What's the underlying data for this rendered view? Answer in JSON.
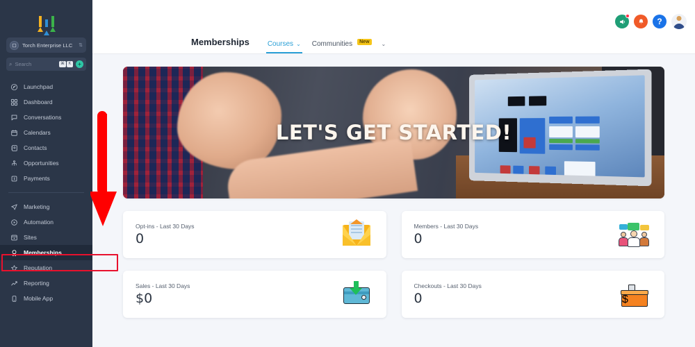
{
  "app": {
    "brand_logo": "three-upward-arrows-logo",
    "accent_blue": "#2a9fd6",
    "sidebar_bg": "#2b3648",
    "annotation_color": "#e8112d"
  },
  "sidebar": {
    "account": {
      "name": "Torch Enterprise LLC",
      "avatar_icon": "building-icon",
      "chevron_icon": "chevron-updown-icon"
    },
    "search": {
      "placeholder": "Search",
      "icon": "search-icon",
      "shortcut_keys": [
        "⌘",
        "K"
      ],
      "add_icon": "plus-icon"
    },
    "items": [
      {
        "label": "Launchpad",
        "icon": "rocket-icon",
        "active": false
      },
      {
        "label": "Dashboard",
        "icon": "grid-icon",
        "active": false
      },
      {
        "label": "Conversations",
        "icon": "chat-bubble-icon",
        "active": false
      },
      {
        "label": "Calendars",
        "icon": "calendar-icon",
        "active": false
      },
      {
        "label": "Contacts",
        "icon": "contact-book-icon",
        "active": false
      },
      {
        "label": "Opportunities",
        "icon": "funnel-icon",
        "active": false
      },
      {
        "label": "Payments",
        "icon": "payment-icon",
        "active": false
      }
    ],
    "items2": [
      {
        "label": "Marketing",
        "icon": "paper-plane-icon",
        "active": false
      },
      {
        "label": "Automation",
        "icon": "play-circle-icon",
        "active": false
      },
      {
        "label": "Sites",
        "icon": "window-icon",
        "active": false
      },
      {
        "label": "Memberships",
        "icon": "award-ribbon-icon",
        "active": true
      },
      {
        "label": "Reputation",
        "icon": "star-icon",
        "active": false
      },
      {
        "label": "Reporting",
        "icon": "trend-up-icon",
        "active": false
      },
      {
        "label": "Mobile App",
        "icon": "mobile-phone-icon",
        "active": false
      }
    ]
  },
  "topbar": {
    "title": "Memberships",
    "tabs": [
      {
        "label": "Courses",
        "active": true,
        "has_chevron": true,
        "badge": ""
      },
      {
        "label": "Communities",
        "active": false,
        "has_chevron": true,
        "badge": "New"
      }
    ],
    "icons": [
      {
        "name": "announcement-icon",
        "color": "#1f9e76",
        "has_dot": true
      },
      {
        "name": "notification-bell-icon",
        "color": "#f05a28",
        "has_dot": false
      },
      {
        "name": "help-question-icon",
        "color": "#1a73e8",
        "glyph": "?",
        "has_dot": false
      },
      {
        "name": "user-avatar",
        "color": "#f0f2f6",
        "has_dot": false
      }
    ]
  },
  "banner": {
    "title": "LET'S GET STARTED!",
    "image_description": "hands-gesturing-over-laptop-photo"
  },
  "cards": [
    {
      "label": "Opt-ins - Last 30 Days",
      "value": "0",
      "icon": "open-envelope-icon"
    },
    {
      "label": "Members - Last 30 Days",
      "value": "0",
      "icon": "people-speech-bubbles-icon"
    },
    {
      "label": "Sales - Last 30 Days",
      "value": "$0",
      "icon": "wallet-download-icon"
    },
    {
      "label": "Checkouts - Last 30 Days",
      "value": "0",
      "icon": "cash-register-icon"
    }
  ],
  "annotations": [
    {
      "name": "red-down-arrow",
      "type": "arrow",
      "target": "Memberships"
    },
    {
      "name": "red-highlight-box",
      "type": "rectangle",
      "target": "Memberships"
    }
  ]
}
